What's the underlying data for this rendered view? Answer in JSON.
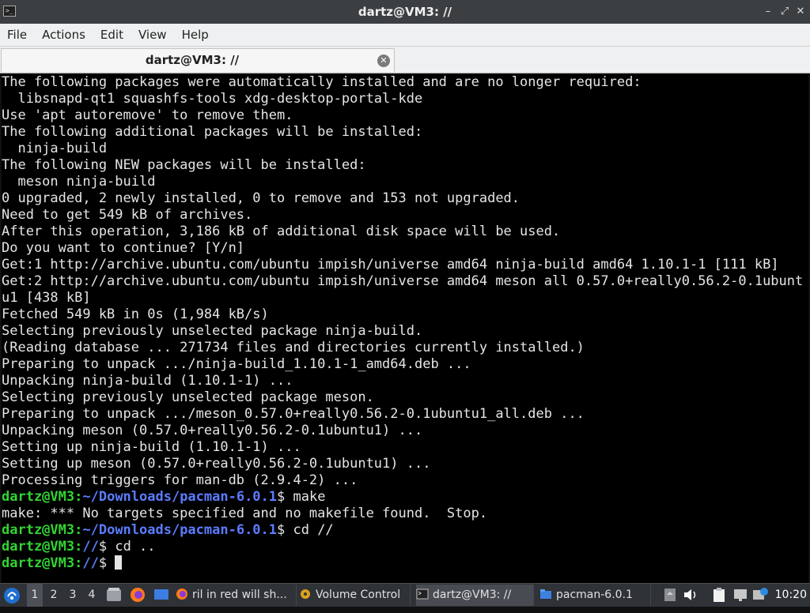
{
  "window": {
    "title": "dartz@VM3: //",
    "controls": [
      "minimize-icon",
      "maximize-icon",
      "close-icon"
    ]
  },
  "menubar": {
    "items": [
      "File",
      "Actions",
      "Edit",
      "View",
      "Help"
    ]
  },
  "tabs": [
    {
      "label": "dartz@VM3: //",
      "active": true
    }
  ],
  "colors": {
    "prompt_user": "#32d432",
    "prompt_path": "#5c7cff",
    "terminal_bg": "#000000",
    "terminal_fg": "#e5e5e5"
  },
  "terminal": {
    "lines": [
      {
        "text": "The following packages were automatically installed and are no longer required:"
      },
      {
        "text": "  libsnapd-qt1 squashfs-tools xdg-desktop-portal-kde"
      },
      {
        "text": "Use 'apt autoremove' to remove them."
      },
      {
        "text": "The following additional packages will be installed:"
      },
      {
        "text": "  ninja-build"
      },
      {
        "text": "The following NEW packages will be installed:"
      },
      {
        "text": "  meson ninja-build"
      },
      {
        "text": "0 upgraded, 2 newly installed, 0 to remove and 153 not upgraded."
      },
      {
        "text": "Need to get 549 kB of archives."
      },
      {
        "text": "After this operation, 3,186 kB of additional disk space will be used."
      },
      {
        "text": "Do you want to continue? [Y/n]"
      },
      {
        "text": "Get:1 http://archive.ubuntu.com/ubuntu impish/universe amd64 ninja-build amd64 1.10.1-1 [111 kB]"
      },
      {
        "text": "Get:2 http://archive.ubuntu.com/ubuntu impish/universe amd64 meson all 0.57.0+really0.56.2-0.1ubunt"
      },
      {
        "text": "u1 [438 kB]"
      },
      {
        "text": "Fetched 549 kB in 0s (1,984 kB/s)"
      },
      {
        "text": "Selecting previously unselected package ninja-build."
      },
      {
        "text": "(Reading database ... 271734 files and directories currently installed.)"
      },
      {
        "text": "Preparing to unpack .../ninja-build_1.10.1-1_amd64.deb ..."
      },
      {
        "text": "Unpacking ninja-build (1.10.1-1) ..."
      },
      {
        "text": "Selecting previously unselected package meson."
      },
      {
        "text": "Preparing to unpack .../meson_0.57.0+really0.56.2-0.1ubuntu1_all.deb ..."
      },
      {
        "text": "Unpacking meson (0.57.0+really0.56.2-0.1ubuntu1) ..."
      },
      {
        "text": "Setting up ninja-build (1.10.1-1) ..."
      },
      {
        "text": "Setting up meson (0.57.0+really0.56.2-0.1ubuntu1) ..."
      },
      {
        "text": "Processing triggers for man-db (2.9.4-2) ..."
      },
      {
        "user": "dartz@VM3",
        "path": "~/Downloads/pacman-6.0.1",
        "cmd": "$ make"
      },
      {
        "text": "make: *** No targets specified and no makefile found.  Stop."
      },
      {
        "user": "dartz@VM3",
        "path": "~/Downloads/pacman-6.0.1",
        "cmd": "$ cd //"
      },
      {
        "user": "dartz@VM3",
        "path": "//",
        "cmd": "$ cd .."
      },
      {
        "user": "dartz@VM3",
        "path": "//",
        "cmd": "$ ",
        "cursor": true
      }
    ]
  },
  "taskbar": {
    "workspaces": [
      "1",
      "2",
      "3",
      "4"
    ],
    "launchers": [
      "file-manager-icon",
      "firefox-icon",
      "desktop-icon"
    ],
    "tasks": [
      {
        "label": "ril in red will sh...",
        "icon": "firefox-icon"
      },
      {
        "label": "Volume Control",
        "icon": "volume-control-icon"
      },
      {
        "label": "dartz@VM3: //",
        "icon": "terminal-icon"
      },
      {
        "label": "pacman-6.0.1",
        "icon": "folder-icon"
      }
    ],
    "tray": [
      "eject-icon",
      "volume-icon",
      "clipboard-icon",
      "network-icon",
      "update-icon"
    ],
    "clock": "10:20"
  }
}
